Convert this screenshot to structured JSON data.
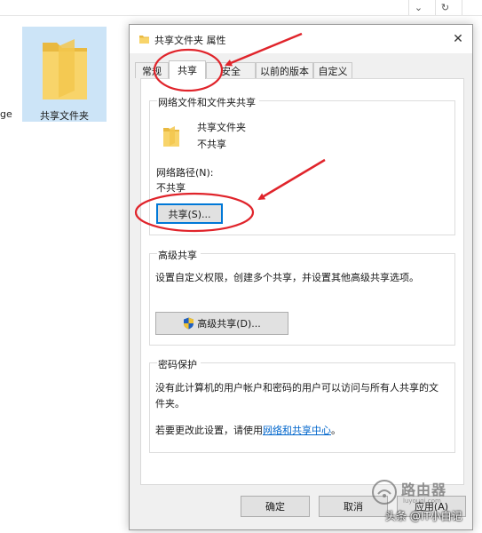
{
  "explorer": {
    "folder_label": "共享文件夹",
    "side_text": "ge",
    "refresh_glyph": "↻"
  },
  "dialog": {
    "title": "共享文件夹 属性",
    "tabs": [
      {
        "label": "常规"
      },
      {
        "label": "共享"
      },
      {
        "label": "安全"
      },
      {
        "label": "以前的版本"
      },
      {
        "label": "自定义"
      }
    ],
    "active_tab": "共享",
    "network_sharing": {
      "group_title": "网络文件和文件夹共享",
      "folder_name": "共享文件夹",
      "folder_status": "不共享",
      "path_label": "网络路径(N):",
      "path_value": "不共享",
      "share_button": "共享(S)..."
    },
    "advanced_sharing": {
      "group_title": "高级共享",
      "description": "设置自定义权限，创建多个共享，并设置其他高级共享选项。",
      "button": "高级共享(D)..."
    },
    "password_protection": {
      "group_title": "密码保护",
      "line1": "没有此计算机的用户帐户和密码的用户可以访问与所有人共享的文",
      "line2": "件夹。",
      "change_prefix": "若要更改此设置，请使用",
      "link": "网络和共享中心",
      "change_suffix": "。"
    },
    "buttons": {
      "ok": "确定",
      "cancel": "取消",
      "apply": "应用(A)"
    }
  },
  "watermark": {
    "brand": "路由器",
    "sub": "luyouqi.com",
    "credit": "头条 @IT小白记"
  },
  "colors": {
    "accent": "#0078d7",
    "annotation": "#e0242b",
    "link": "#0066cc",
    "selection": "#cce4f7"
  }
}
